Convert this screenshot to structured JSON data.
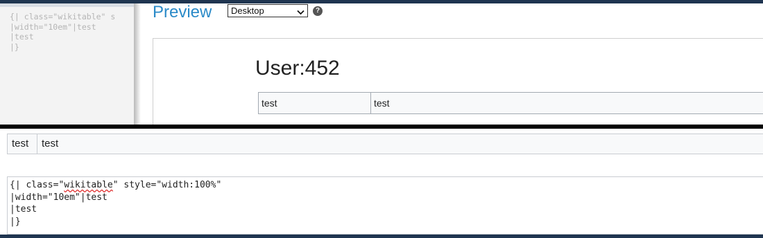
{
  "top": {
    "editor_lines": [
      "{| class=\"wikitable\" s",
      "|width=\"10em\"|test",
      "|test",
      "|}"
    ],
    "preview_title": "Preview",
    "device_select": {
      "value": "Desktop"
    },
    "help_icon": "?",
    "preview_heading": "User:452",
    "preview_table": {
      "cells": [
        "test",
        "test"
      ]
    }
  },
  "bottom": {
    "rendered_table": {
      "cells": [
        "test",
        "test"
      ]
    },
    "source": {
      "line1_prefix": "{| class=\"",
      "line1_word": "wikitable",
      "line1_suffix": "\" style=\"width:100%\"",
      "line2": "|width=\"10em\"|test",
      "line3": "|test",
      "line4": "|}"
    }
  },
  "colors": {
    "accent": "#2a8ac8",
    "top_bar": "#1f3550",
    "divider": "#000000"
  },
  "icons": {
    "help": "question-circle-icon",
    "dropdown": "chevron-down-icon"
  }
}
